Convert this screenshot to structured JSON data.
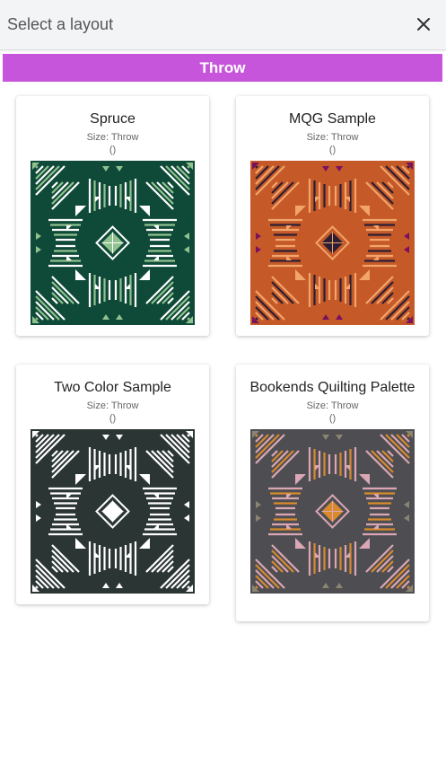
{
  "header": {
    "title": "Select a layout",
    "close_label": "×"
  },
  "section": {
    "label": "Throw"
  },
  "layouts": [
    {
      "title": "Spruce",
      "size": "Size: Throw",
      "count": "()",
      "colors": {
        "bg": "#0f4a38",
        "light": "#ffffff",
        "mid": "#8fc28e",
        "accent": "#8fc28e"
      }
    },
    {
      "title": "MQG Sample",
      "size": "Size: Throw",
      "count": "()",
      "colors": {
        "bg": "#c55a28",
        "light": "#f2a46b",
        "mid": "#2a1f35",
        "accent": "#7a1060"
      }
    },
    {
      "title": "Two Color Sample",
      "size": "Size: Throw",
      "count": "()",
      "colors": {
        "bg": "#2b3534",
        "light": "#ffffff",
        "mid": "#ffffff",
        "accent": "#ffffff"
      }
    },
    {
      "title": "Bookends Quilting Palette",
      "size": "Size: Throw",
      "count": "()",
      "colors": {
        "bg": "#4e4e52",
        "light": "#dba7b4",
        "mid": "#d88a2d",
        "accent": "#8a8470"
      }
    }
  ]
}
